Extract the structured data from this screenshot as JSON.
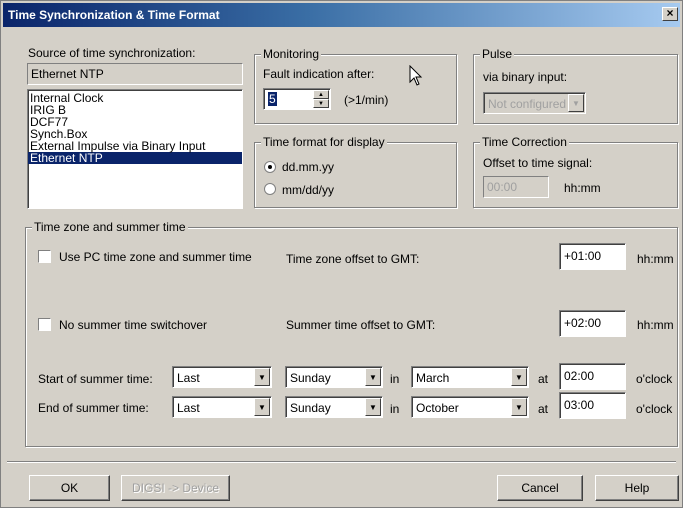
{
  "window": {
    "title": "Time Synchronization & Time Format",
    "close": "×"
  },
  "source": {
    "label": "Source of time synchronization:",
    "current": "Ethernet NTP",
    "options": [
      "Internal Clock",
      "IRIG B",
      "DCF77",
      "Synch.Box",
      "External Impulse via Binary Input",
      "Ethernet NTP"
    ],
    "selected_index": 5
  },
  "monitoring": {
    "title": "Monitoring",
    "fault_label": "Fault indication after:",
    "fault_value": "5",
    "unit": "(>1/min)"
  },
  "time_format": {
    "title": "Time format for display",
    "options": [
      "dd.mm.yy",
      "mm/dd/yy"
    ],
    "selected_index": 0
  },
  "pulse": {
    "title": "Pulse",
    "binary_label": "via binary input:",
    "binary_value": "Not configured"
  },
  "time_correction": {
    "title": "Time Correction",
    "offset_label": "Offset to time signal:",
    "offset_value": "00:00",
    "unit": "hh:mm"
  },
  "timezone": {
    "title": "Time zone and summer time",
    "use_pc_label": "Use PC time zone and summer time",
    "use_pc_checked": false,
    "tz_offset_label": "Time zone offset to GMT:",
    "tz_offset_value": "+01:00",
    "tz_offset_unit": "hh:mm",
    "no_switchover_label": "No summer time switchover",
    "no_switchover_checked": false,
    "summer_offset_label": "Summer time offset to GMT:",
    "summer_offset_value": "+02:00",
    "summer_offset_unit": "hh:mm",
    "start": {
      "label": "Start of summer time:",
      "week": "Last",
      "day": "Sunday",
      "in": "in",
      "month": "March",
      "at": "at",
      "time": "02:00",
      "unit": "o'clock"
    },
    "end": {
      "label": "End of summer time:",
      "week": "Last",
      "day": "Sunday",
      "in": "in",
      "month": "October",
      "at": "at",
      "time": "03:00",
      "unit": "o'clock"
    }
  },
  "buttons": {
    "ok": "OK",
    "digsi": "DIGSI -> Device",
    "cancel": "Cancel",
    "help": "Help"
  },
  "icons": {
    "close": "close-icon",
    "dropdown": "chevron-down-icon",
    "spin": "spin-arrows-icon",
    "cursor": "mouse-pointer-icon"
  },
  "colors": {
    "face": "#d4d0c8",
    "titlebar_start": "#0a246a",
    "titlebar_end": "#a6caf0",
    "selection": "#0a246a"
  }
}
